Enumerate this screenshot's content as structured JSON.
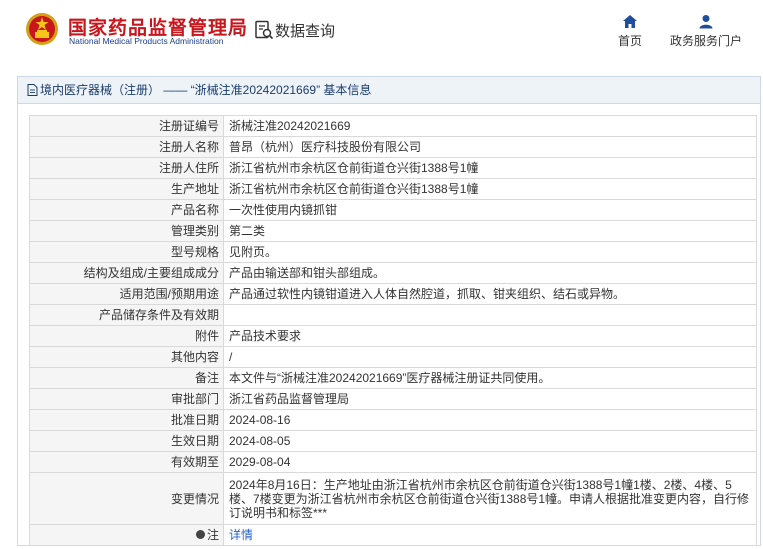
{
  "header": {
    "brand_cn": "国家药品监督管理局",
    "brand_en": "National Medical Products Administration",
    "query_title": "数据查询",
    "nav": [
      {
        "label": "首页",
        "icon": "home-icon"
      },
      {
        "label": "政务服务门户",
        "icon": "user-icon"
      }
    ]
  },
  "panel": {
    "title": "境内医疗器械（注册） ——  “浙械注准20242021669” 基本信息"
  },
  "rows": [
    {
      "key": "注册证编号",
      "value": "浙械注准20242021669"
    },
    {
      "key": "注册人名称",
      "value": "普昂（杭州）医疗科技股份有限公司"
    },
    {
      "key": "注册人住所",
      "value": "浙江省杭州市余杭区仓前街道仓兴街1388号1幢"
    },
    {
      "key": "生产地址",
      "value": "浙江省杭州市余杭区仓前街道仓兴街1388号1幢"
    },
    {
      "key": "产品名称",
      "value": "一次性使用内镜抓钳"
    },
    {
      "key": "管理类别",
      "value": "第二类"
    },
    {
      "key": "型号规格",
      "value": "见附页。"
    },
    {
      "key": "结构及组成/主要组成成分",
      "value": "产品由输送部和钳头部组成。"
    },
    {
      "key": "适用范围/预期用途",
      "value": "产品通过软性内镜钳道进入人体自然腔道，抓取、钳夹组织、结石或异物。"
    },
    {
      "key": "产品储存条件及有效期",
      "value": ""
    },
    {
      "key": "附件",
      "value": "产品技术要求"
    },
    {
      "key": "其他内容",
      "value": "/"
    },
    {
      "key": "备注",
      "value": "本文件与“浙械注准20242021669”医疗器械注册证共同使用。"
    },
    {
      "key": "审批部门",
      "value": "浙江省药品监督管理局"
    },
    {
      "key": "批准日期",
      "value": "2024-08-16"
    },
    {
      "key": "生效日期",
      "value": "2024-08-05"
    },
    {
      "key": "有效期至",
      "value": "2029-08-04"
    },
    {
      "key": "变更情况",
      "value": "2024年8月16日：生产地址由浙江省杭州市余杭区仓前街道仓兴街1388号1幢1楼、2楼、4楼、5楼、7楼变更为浙江省杭州市余杭区仓前街道仓兴街1388号1幢。申请人根据批准变更内容，自行修订说明书和标签***"
    }
  ],
  "note_row": {
    "key": "注",
    "link": "详情"
  },
  "colors": {
    "brand_red": "#c8161d",
    "brand_blue": "#1b3f8a",
    "link_blue": "#2a63c9",
    "title_blue": "#1a3c6e"
  }
}
